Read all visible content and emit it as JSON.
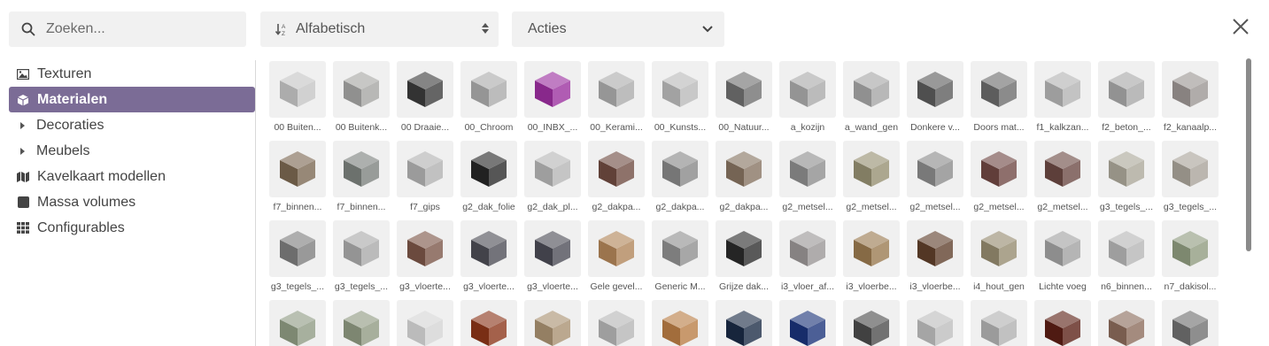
{
  "search": {
    "placeholder": "Zoeken..."
  },
  "sort": {
    "label": "Alfabetisch"
  },
  "actions": {
    "label": "Acties"
  },
  "sidebar": {
    "items": [
      {
        "label": "Texturen",
        "icon": "image-icon",
        "active": false,
        "expandable": false
      },
      {
        "label": "Materialen",
        "icon": "cube-icon",
        "active": true,
        "expandable": false
      },
      {
        "label": "Decoraties",
        "icon": "caret-right-icon",
        "active": false,
        "expandable": true
      },
      {
        "label": "Meubels",
        "icon": "caret-right-icon",
        "active": false,
        "expandable": true
      },
      {
        "label": "Kavelkaart modellen",
        "icon": "map-icon",
        "active": false,
        "expandable": false
      },
      {
        "label": "Massa volumes",
        "icon": "square-icon",
        "active": false,
        "expandable": false
      },
      {
        "label": "Configurables",
        "icon": "grid-icon",
        "active": false,
        "expandable": false
      }
    ]
  },
  "materials": [
    {
      "label": "00 Buiten...",
      "color": "#c4c4c4"
    },
    {
      "label": "00 Buitenk...",
      "color": "#a4a4a2"
    },
    {
      "label": "00 Draaie...",
      "color": "#3a3a3a"
    },
    {
      "label": "00_Chroom",
      "color": "#a9a9a9"
    },
    {
      "label": "00_INBX_...",
      "color": "#9a2e9e"
    },
    {
      "label": "00_Kerami...",
      "color": "#ababab"
    },
    {
      "label": "00_Kunsts...",
      "color": "#b8b8b8"
    },
    {
      "label": "00_Natuur...",
      "color": "#6e6e6e"
    },
    {
      "label": "a_kozijn",
      "color": "#a8a8a8"
    },
    {
      "label": "a_wand_gen",
      "color": "#a4a4a4"
    },
    {
      "label": "Donkere v...",
      "color": "#5a5a5a"
    },
    {
      "label": "Doors mat...",
      "color": "#6a6a6a"
    },
    {
      "label": "f1_kalkzan...",
      "color": "#b2b2b2"
    },
    {
      "label": "f2_beton_...",
      "color": "#a6a6a6"
    },
    {
      "label": "f2_kanaalp...",
      "color": "#9a9492"
    },
    {
      "label": "f7_binnen...",
      "color": "#7a6650"
    },
    {
      "label": "f7_binnen...",
      "color": "#7b807c"
    },
    {
      "label": "f7_gips",
      "color": "#b0b0b0"
    },
    {
      "label": "g2_dak_folie",
      "color": "#262626"
    },
    {
      "label": "g2_dak_pl...",
      "color": "#b4b4b4"
    },
    {
      "label": "g2_dakpa...",
      "color": "#6e4a40"
    },
    {
      "label": "g2_dakpa...",
      "color": "#868686"
    },
    {
      "label": "g2_dakpa...",
      "color": "#857260"
    },
    {
      "label": "g2_metsel...",
      "color": "#8c8c8c"
    },
    {
      "label": "g2_metsel...",
      "color": "#948e70"
    },
    {
      "label": "g2_metsel...",
      "color": "#8a8a8a"
    },
    {
      "label": "g2_metsel...",
      "color": "#6e4642"
    },
    {
      "label": "g2_metsel...",
      "color": "#6a4842"
    },
    {
      "label": "g3_tegels_...",
      "color": "#aaa698"
    },
    {
      "label": "g3_tegels_...",
      "color": "#a8a298"
    },
    {
      "label": "g3_tegels_...",
      "color": "#7c7c7c"
    },
    {
      "label": "g3_tegels_...",
      "color": "#a8a8a8"
    },
    {
      "label": "g3_vloerte...",
      "color": "#7a5446"
    },
    {
      "label": "g3_vloerte...",
      "color": "#4c4c54"
    },
    {
      "label": "g3_vloerte...",
      "color": "#4a4a54"
    },
    {
      "label": "Gele gevel...",
      "color": "#b08458"
    },
    {
      "label": "Generic M...",
      "color": "#8e8e8e"
    },
    {
      "label": "Grijze dak...",
      "color": "#2a2a2a"
    },
    {
      "label": "i3_vloer_af...",
      "color": "#989494"
    },
    {
      "label": "i3_vloerbe...",
      "color": "#98784e"
    },
    {
      "label": "i3_vloerbe...",
      "color": "#5e3e2a"
    },
    {
      "label": "i4_hout_gen",
      "color": "#948a6e"
    },
    {
      "label": "Lichte voeg",
      "color": "#a0a0a0"
    },
    {
      "label": "n6_binnen...",
      "color": "#b4b4b4"
    },
    {
      "label": "n7_dakisol...",
      "color": "#8e9a7e"
    },
    {
      "label": "",
      "color": "#8e9a82"
    },
    {
      "label": "",
      "color": "#8e9880"
    },
    {
      "label": "",
      "color": "#d4d4d4"
    },
    {
      "label": "",
      "color": "#8a3418"
    },
    {
      "label": "",
      "color": "#a89070"
    },
    {
      "label": "",
      "color": "#b4b4b4"
    },
    {
      "label": "",
      "color": "#b87c44"
    },
    {
      "label": "",
      "color": "#1a2a44"
    },
    {
      "label": "",
      "color": "#1a3278"
    },
    {
      "label": "",
      "color": "#4a4a4a"
    },
    {
      "label": "",
      "color": "#bcbcbc"
    },
    {
      "label": "",
      "color": "#b0b0b0"
    },
    {
      "label": "",
      "color": "#5a1e14"
    },
    {
      "label": "",
      "color": "#8a6a5a"
    },
    {
      "label": "",
      "color": "#6e6e6e"
    }
  ]
}
